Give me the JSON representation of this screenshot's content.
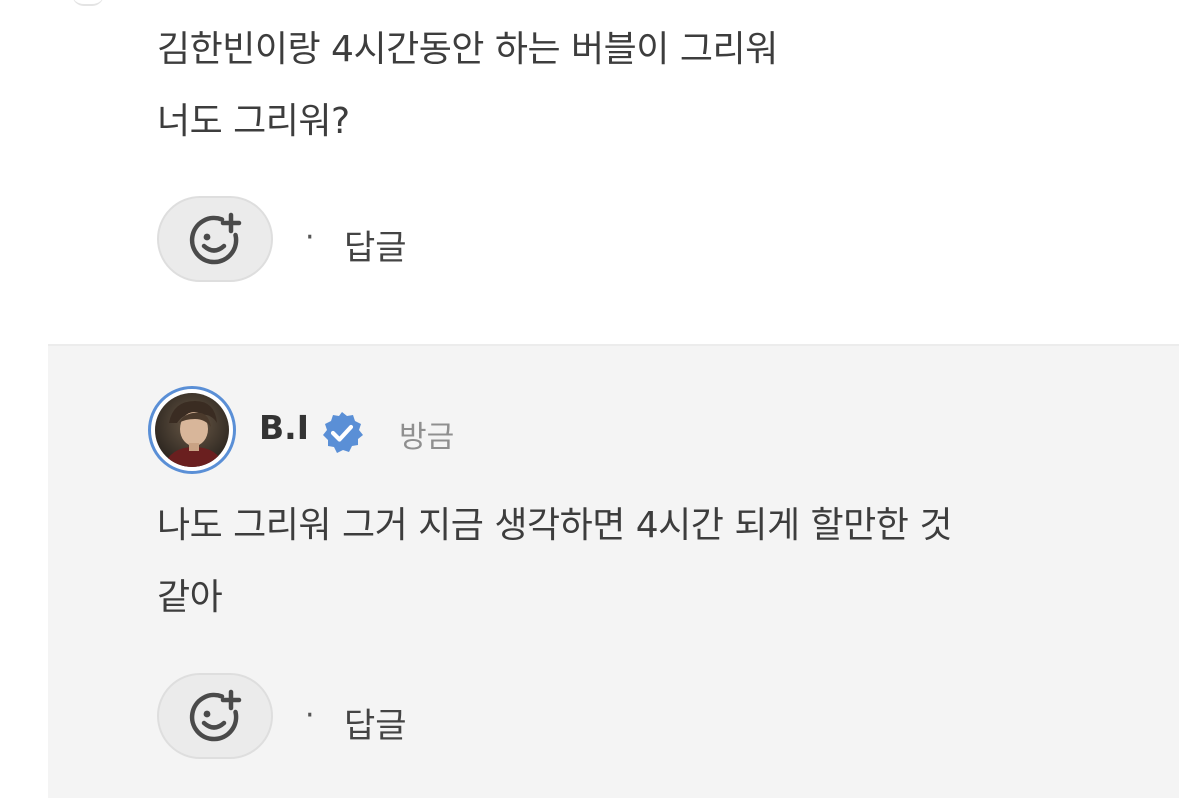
{
  "top_comment": {
    "lines": [
      "김한빈이랑 4시간동안 하는 버블이 그리워",
      "너도 그리워?"
    ],
    "reply_label": "답글",
    "separator": "·"
  },
  "reply": {
    "username": "B.I",
    "timestamp": "방금",
    "lines": [
      "나도 그리워 그거 지금 생각하면 4시간 되게 할만한 것",
      "같아"
    ],
    "reply_label": "답글",
    "separator": "·"
  },
  "icons": {
    "reaction": "add-reaction-icon",
    "verified": "verified-badge-icon"
  },
  "colors": {
    "verified_badge": "#5a8fd6",
    "avatar_ring": "#5a8fd6",
    "reply_background": "#f4f4f4",
    "text": "#3d3d3d",
    "timestamp": "#8f8f8f"
  }
}
